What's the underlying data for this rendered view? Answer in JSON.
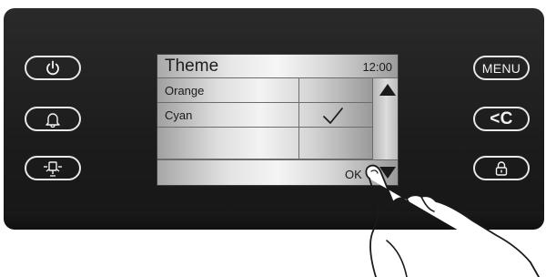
{
  "left_buttons": [
    {
      "icon": "power-icon"
    },
    {
      "icon": "bell-icon"
    },
    {
      "icon": "light-bulb-icon"
    }
  ],
  "right_buttons": [
    {
      "label": "MENU"
    },
    {
      "label": "<C",
      "icon": "back-clear-icon"
    },
    {
      "icon": "lock-icon"
    }
  ],
  "screen": {
    "title": "Theme",
    "time": "12:00",
    "options": [
      {
        "label": "Orange",
        "selected": false
      },
      {
        "label": "Cyan",
        "selected": true
      },
      {
        "label": "",
        "selected": false
      }
    ],
    "ok_label": "OK",
    "scroll_up_icon": "triangle-up-icon",
    "scroll_down_icon": "triangle-down-icon"
  },
  "colors": {
    "panel": "#1c1c1c",
    "button_outline": "#e8e8e8",
    "screen_text": "#1a1a1a"
  }
}
